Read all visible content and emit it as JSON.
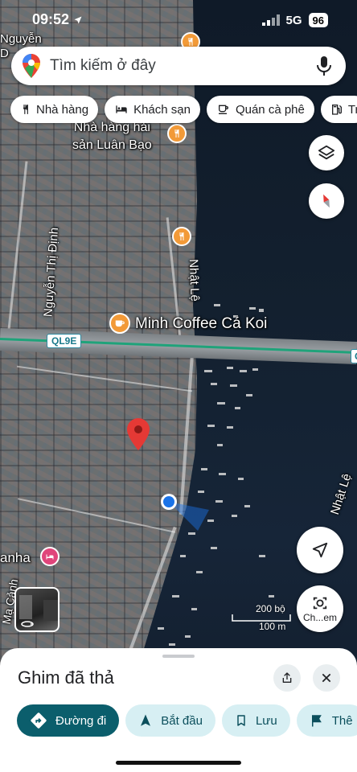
{
  "status_bar": {
    "time": "09:52",
    "network": "5G",
    "battery": "96"
  },
  "search": {
    "placeholder": "Tìm kiếm ở đây"
  },
  "chips": [
    {
      "label": "Nhà hàng",
      "icon": "fork-knife-icon"
    },
    {
      "label": "Khách sạn",
      "icon": "bed-icon"
    },
    {
      "label": "Quán cà phê",
      "icon": "coffee-cup-icon"
    },
    {
      "label": "Tr",
      "icon": "gas-pump-icon"
    }
  ],
  "map": {
    "labels": {
      "street_nguyen_d": "Nguyễn\nD",
      "restaurant_1": "Nhà hàng hải\nsản Luân Bạo",
      "street_nguyen_thi_dinh": "Nguyễn Thị Định",
      "street_nhat_le": "Nhật Lệ",
      "street_nhat_le_2": "Nhật Lệ",
      "minh_coffee": "Minh Coffee Cá Koi",
      "route": "QL9E",
      "route_right": "Q",
      "anha": "anha",
      "ma_canh": "Mạ Cảnh"
    },
    "scale": {
      "feet": "200 bộ",
      "meters": "100 m"
    },
    "colors": {
      "pin_red": "#e53935",
      "location_blue": "#1a73e8",
      "poi_orange": "#f29a38",
      "hotel_pink": "#e0457b",
      "bridge_route": "#1fa37a"
    }
  },
  "fab": {
    "layers_icon": "layers-icon",
    "compass_icon": "compass-icon",
    "locate_icon": "locate-arrow-icon",
    "lens_label": "Ch...em"
  },
  "sheet": {
    "title": "Ghim đã thả",
    "actions": [
      {
        "label": "Đường đi",
        "icon": "directions-icon",
        "primary": true
      },
      {
        "label": "Bắt đầu",
        "icon": "navigation-arrow-icon"
      },
      {
        "label": "Lưu",
        "icon": "bookmark-icon"
      },
      {
        "label": "Thê",
        "icon": "flag-icon"
      }
    ]
  }
}
